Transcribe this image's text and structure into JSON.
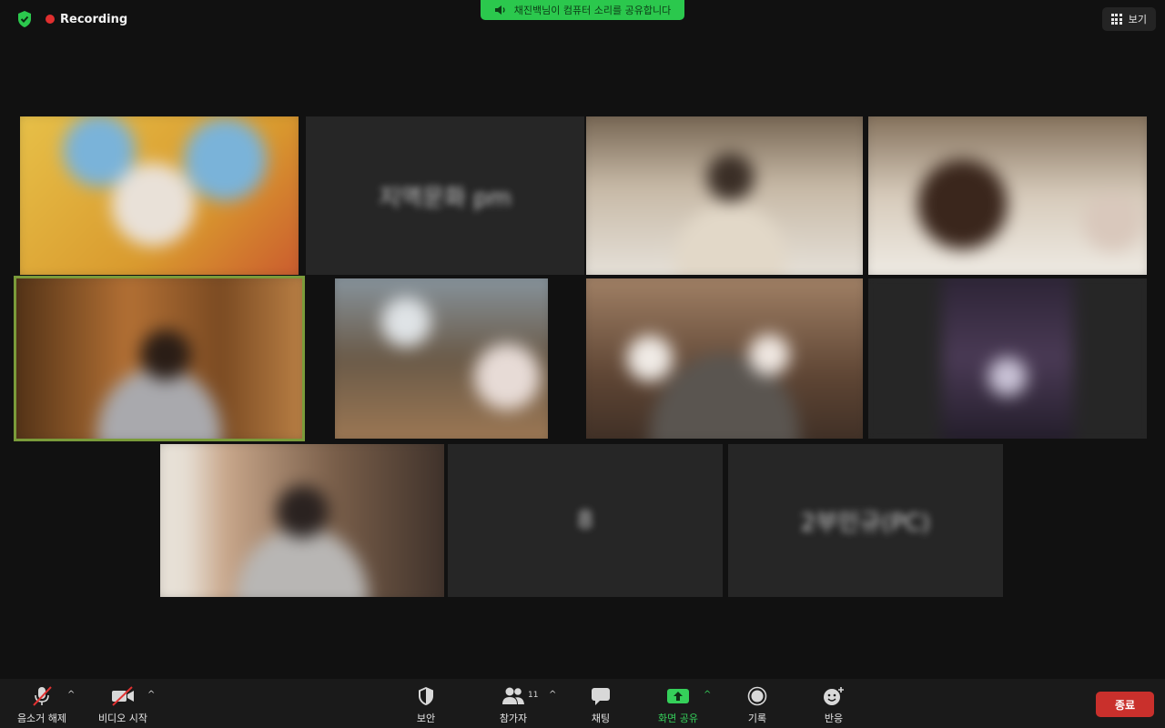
{
  "top_bar": {
    "recording_label": "Recording",
    "share_notice": "채진백님이 컴퓨터 소리를 공유합니다",
    "view_label": "보기"
  },
  "tiles": [
    {
      "id": "p1",
      "kind": "video",
      "active": false
    },
    {
      "id": "p2",
      "kind": "name",
      "name": "지역문화 pm"
    },
    {
      "id": "p3",
      "kind": "video",
      "active": false
    },
    {
      "id": "p4",
      "kind": "video",
      "active": false
    },
    {
      "id": "p5",
      "kind": "video",
      "active": true
    },
    {
      "id": "p6",
      "kind": "video",
      "active": false
    },
    {
      "id": "p7",
      "kind": "video",
      "active": false
    },
    {
      "id": "p8",
      "kind": "video",
      "active": false
    },
    {
      "id": "p9",
      "kind": "video",
      "active": false
    },
    {
      "id": "p10",
      "kind": "name",
      "name": "8"
    },
    {
      "id": "p11",
      "kind": "name",
      "name": "2부민규(PC)"
    }
  ],
  "toolbar": {
    "unmute_label": "음소거 해제",
    "start_video_label": "비디오 시작",
    "security_label": "보안",
    "participants_label": "참가자",
    "participants_count": "11",
    "chat_label": "채팅",
    "share_screen_label": "화면 공유",
    "record_label": "기록",
    "reactions_label": "반응",
    "end_label": "종료"
  },
  "colors": {
    "accent_green": "#35d05a",
    "banner_green": "#2bc84d",
    "end_red": "#c9302c",
    "recording_red": "#e02f2f"
  }
}
